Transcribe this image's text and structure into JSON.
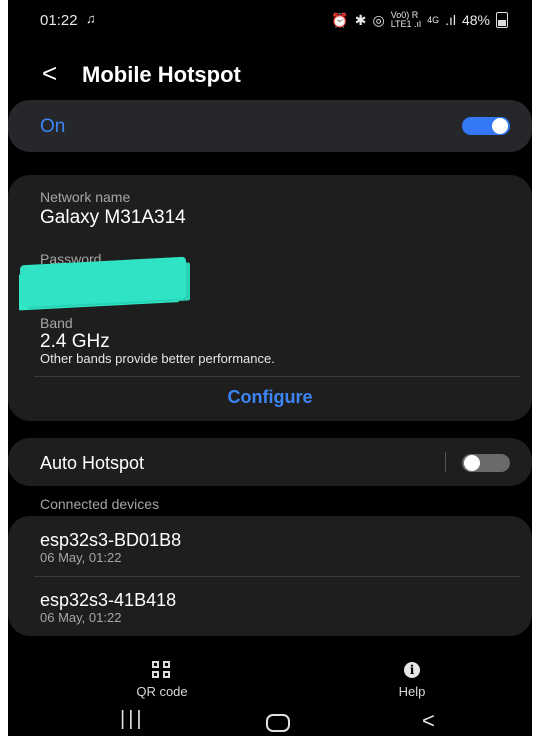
{
  "status_bar": {
    "time": "01:22",
    "time_icon": "notification-icon",
    "indicators": [
      "alarm-icon",
      "bluetooth-icon",
      "hotspot-icon"
    ],
    "volte": "Vo0) R\nLTE1 .ıl",
    "network": "4G",
    "battery_percent": "48%",
    "battery_icon": "battery-icon"
  },
  "header": {
    "title": "Mobile Hotspot",
    "back_icon": "back-arrow-icon"
  },
  "hotspot_toggle": {
    "label": "On",
    "enabled": true,
    "accent": "#3d85f5"
  },
  "network": {
    "name_label": "Network name",
    "name_value": "Galaxy M31A314",
    "password_label": "Password",
    "band_label": "Band",
    "band_value": "2.4 GHz",
    "band_note": "Other bands provide better performance.",
    "configure_label": "Configure"
  },
  "auto_hotspot": {
    "label": "Auto Hotspot",
    "enabled": false
  },
  "connected_devices": {
    "section_label": "Connected devices",
    "items": [
      {
        "name": "esp32s3-BD01B8",
        "time": "06 May, 01:22"
      },
      {
        "name": "esp32s3-41B418",
        "time": "06 May, 01:22"
      }
    ]
  },
  "bottom_actions": {
    "qr_label": "QR code",
    "help_label": "Help"
  },
  "nav_bar": {
    "recent_glyph": "|||",
    "back_glyph": "<"
  }
}
